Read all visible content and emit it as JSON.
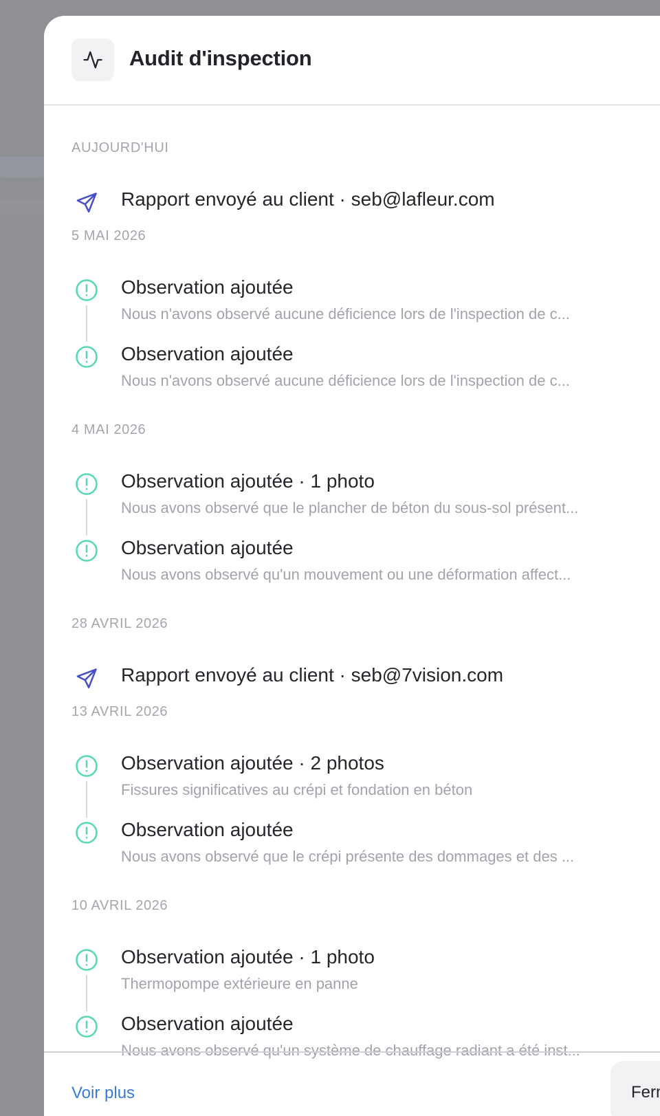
{
  "header": {
    "title": "Audit d'inspection",
    "icon": "activity-icon"
  },
  "groups": [
    {
      "title": "AUJOURD'HUI",
      "items": [
        {
          "type": "send",
          "title": "Rapport envoyé au client · seb@lafleur.com",
          "desc": ""
        }
      ]
    },
    {
      "title": "5 MAI 2026",
      "items": [
        {
          "type": "observation",
          "title": "Observation ajoutée",
          "desc": "Nous n'avons observé aucune déficience lors de l'inspection de c..."
        },
        {
          "type": "observation",
          "title": "Observation ajoutée",
          "desc": "Nous n'avons observé aucune déficience lors de l'inspection de c..."
        }
      ]
    },
    {
      "title": "4 MAI 2026",
      "items": [
        {
          "type": "observation",
          "title": "Observation ajoutée · 1 photo",
          "desc": "Nous avons observé que le plancher de béton du sous-sol présent..."
        },
        {
          "type": "observation",
          "title": "Observation ajoutée",
          "desc": "Nous avons observé qu'un mouvement ou une déformation affect..."
        }
      ]
    },
    {
      "title": "28 AVRIL 2026",
      "items": [
        {
          "type": "send",
          "title": "Rapport envoyé au client · seb@7vision.com",
          "desc": ""
        }
      ]
    },
    {
      "title": "13 AVRIL 2026",
      "items": [
        {
          "type": "observation",
          "title": "Observation ajoutée · 2 photos",
          "desc": "Fissures significatives au crépi et fondation en béton"
        },
        {
          "type": "observation",
          "title": "Observation ajoutée",
          "desc": "Nous avons observé que le crépi présente des dommages et des ..."
        }
      ]
    },
    {
      "title": "10 AVRIL 2026",
      "items": [
        {
          "type": "observation",
          "title": "Observation ajoutée · 1 photo",
          "desc": "Thermopompe extérieure en panne"
        },
        {
          "type": "observation",
          "title": "Observation ajoutée",
          "desc": "Nous avons observé qu'un système de chauffage radiant a été inst..."
        }
      ]
    }
  ],
  "footer": {
    "more_label": "Voir plus",
    "close_label": "Fermer"
  },
  "colors": {
    "send": "#4a4fc4",
    "observation": "#5ad7b6",
    "link": "#3a7bd5"
  }
}
